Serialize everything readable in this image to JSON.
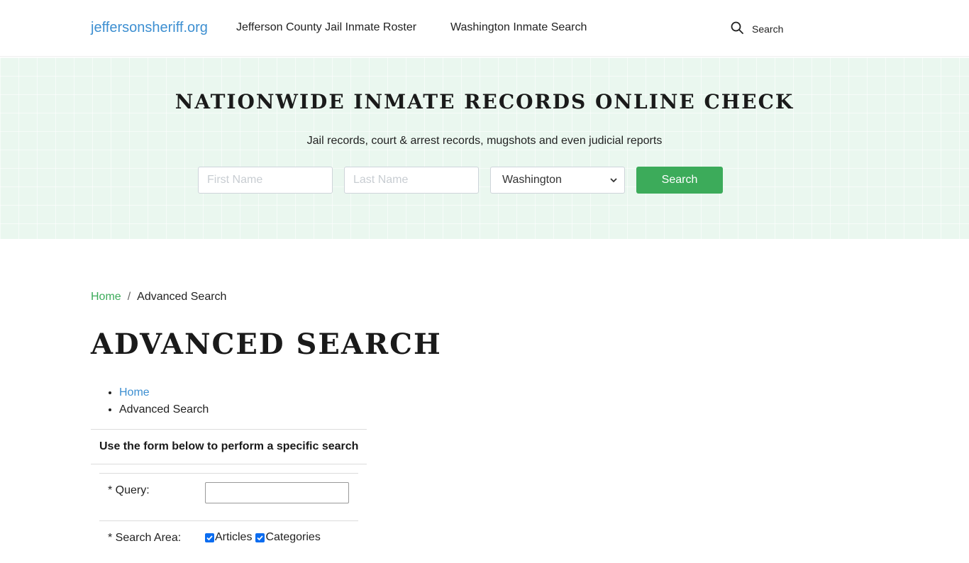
{
  "header": {
    "logo": "jeffersonsheriff.org",
    "nav": [
      "Jefferson County Jail Inmate Roster",
      "Washington Inmate Search"
    ],
    "search_label": "Search"
  },
  "hero": {
    "title": "NATIONWIDE INMATE RECORDS ONLINE CHECK",
    "subtitle": "Jail records, court & arrest records, mugshots and even judicial reports",
    "first_name_placeholder": "First Name",
    "last_name_placeholder": "Last Name",
    "state_selected": "Washington",
    "search_button": "Search",
    "colors": {
      "accent": "#3cab5a",
      "background": "#eaf7ef"
    }
  },
  "breadcrumb": {
    "home": "Home",
    "separator": "/",
    "current": "Advanced Search"
  },
  "page": {
    "title": "ADVANCED SEARCH",
    "list": [
      "Home",
      "Advanced Search"
    ]
  },
  "form": {
    "heading": "Use the form below to perform a specific search",
    "query_label": "* Query:",
    "query_value": "",
    "area_label": "* Search Area:",
    "areas": [
      {
        "label": "Articles",
        "checked": true
      },
      {
        "label": "Categories",
        "checked": true
      }
    ]
  },
  "icons": {
    "header_search": "search-icon",
    "select_caret": "chevron-down-icon",
    "checkbox": "check-icon"
  }
}
